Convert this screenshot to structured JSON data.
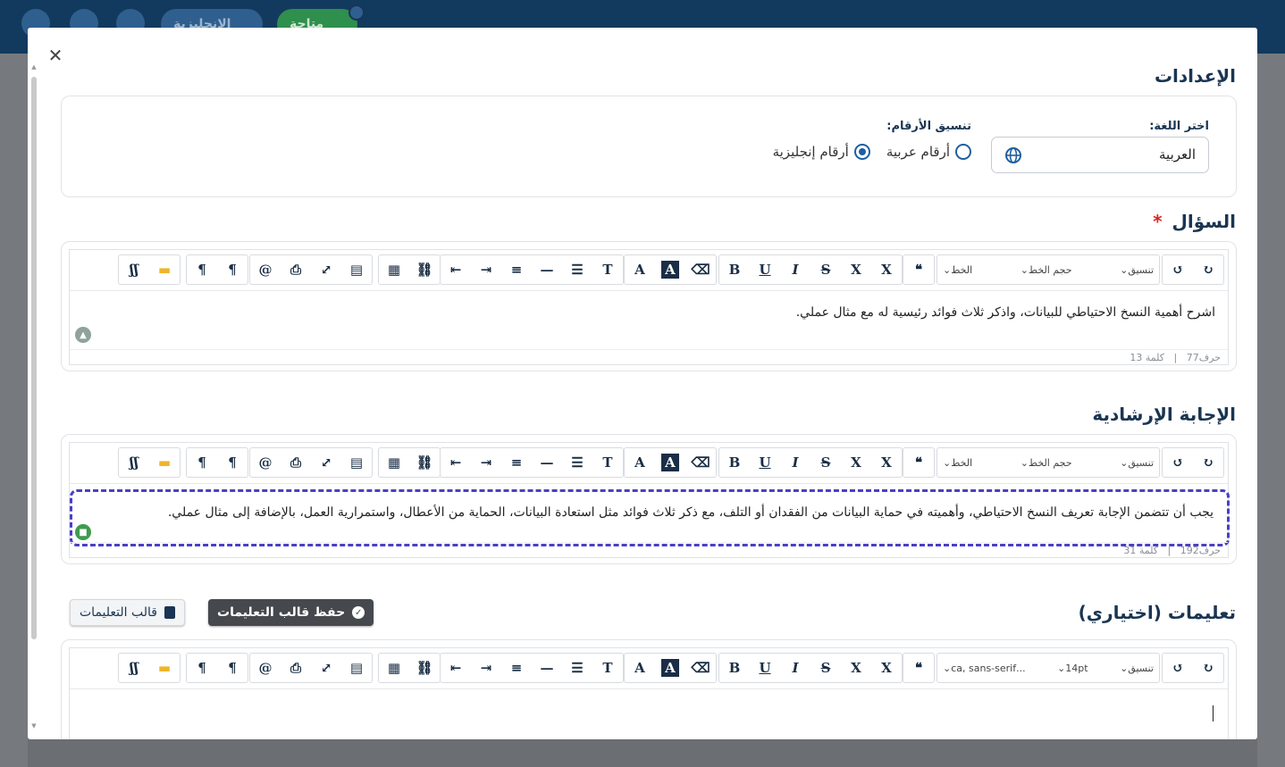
{
  "topbar": {
    "pill_1": "الإنجليزية",
    "pill_2": "متاحة"
  },
  "modal": {
    "close_icon": "close-icon",
    "settings": {
      "title": "الإعدادات",
      "language_label": "اختر اللغة:",
      "language_value": "العربية",
      "number_format_label": "تنسيق الأرقام:",
      "option_arabic_numerals": "أرقام عربية",
      "option_english_numerals": "أرقام إنجليزية",
      "selected_option": "أرقام إنجليزية"
    },
    "toolbar": {
      "format_dd": "تنسيق",
      "font_size_dd": "حجم الخط",
      "font_dd": "الخط",
      "font_size_14": "14pt",
      "font_sans": "...ca, sans-serif"
    },
    "question": {
      "title": "السؤال",
      "required_mark": "*",
      "text": "اشرح أهمية النسخ الاحتياطي للبيانات، واذكر ثلاث فوائد رئيسية له مع مثال عملي.",
      "chars": "حرف77",
      "words": "كلمة 13",
      "separator": "|"
    },
    "guide_answer": {
      "title": "الإجابة الإرشادية",
      "text": "يجب أن تتضمن الإجابة تعريف النسخ الاحتياطي، وأهميته في حماية البيانات من الفقدان أو التلف، مع ذكر ثلاث فوائد مثل استعادة البيانات، الحماية من الأعطال، واستمرارية العمل، بالإضافة إلى مثال عملي.",
      "chars": "حرف192",
      "words": "كلمة 31",
      "separator": "|"
    },
    "instructions": {
      "title": "تعليمات (اختياري)",
      "save_template_button": "حفظ قالب التعليمات",
      "template_button": "قالب التعليمات"
    }
  },
  "colors": {
    "topbar": "#123a5e",
    "title": "#1a3552",
    "radio": "#1d5fa0",
    "dashed": "#4a3fc4",
    "dark_button": "#45494e"
  }
}
